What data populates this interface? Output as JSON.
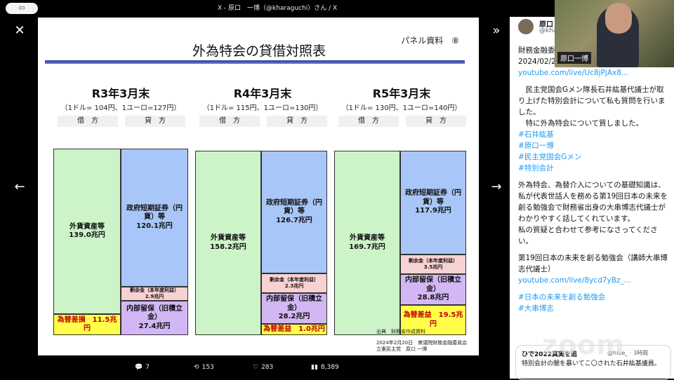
{
  "window": {
    "title": "X - 原口　一博（@kharaguchi）さん / X",
    "pill_label": "▭"
  },
  "slide": {
    "panel_note": "パネル資料　⑧",
    "title": "外為特会の貸借対照表",
    "columns": [
      {
        "heading": "R3年3月末",
        "rate": "（1ドル= 104円、1ユーロ=127円）",
        "left_hdr": "借　方",
        "right_hdr": "貸　方",
        "asset": [
          "外貨資産等",
          "139.0兆円"
        ],
        "liab": [
          "政府短期証券（円貨）等",
          "120.1兆円"
        ],
        "surplus": [
          "剰余金（本年度利益）",
          "2.9兆円"
        ],
        "reserve": [
          "内部留保（旧積立金）",
          "27.4兆円"
        ],
        "fx": "為替差損　11.5兆円"
      },
      {
        "heading": "R4年3月末",
        "rate": "（1ドル= 115円、1ユーロ=130円）",
        "left_hdr": "借　方",
        "right_hdr": "貸　方",
        "asset": [
          "外貨資産等",
          "158.2兆円"
        ],
        "liab": [
          "政府短期証券（円貨）等",
          "126.7兆円"
        ],
        "surplus": [
          "剰余金（本年度利益）",
          "2.3兆円"
        ],
        "reserve": [
          "内部留保（旧積立金）",
          "28.2兆円"
        ],
        "fx": "為替差益　1.0兆円"
      },
      {
        "heading": "R5年3月末",
        "rate": "（1ドル= 130円、1ユーロ=140円）",
        "left_hdr": "借　方",
        "right_hdr": "貸　方",
        "asset": [
          "外貨資産等",
          "169.7兆円"
        ],
        "liab": [
          "政府短期証券（円貨）等",
          "117.9兆円"
        ],
        "surplus": [
          "剰余金（本年度利益）",
          "3.5兆円"
        ],
        "reserve": [
          "内部留保（旧積立金）",
          "28.8兆円"
        ],
        "fx": "為替差益　19.5兆円"
      }
    ],
    "source": "出典　財務省作成資料",
    "footer_lines": [
      "2024年2月20日　衆議院財務金融委員会",
      "立憲民主党　原口 一博"
    ]
  },
  "actions": {
    "replies": "7",
    "reposts": "153",
    "likes": "283",
    "views": "8,389"
  },
  "sidebar": {
    "name": "原口",
    "handle": "@kha",
    "lines": [
      {
        "text": "財務金融委",
        "link": false
      },
      {
        "text": "2024/02/20",
        "link": false
      },
      {
        "text": "youtube.com/live/Uc8jPjAx8...",
        "link": true
      },
      {
        "text": "",
        "link": false
      },
      {
        "text": "　民主党国会Gメン隊長石井紘基代議士が取り上げた特別会計について私も質問を行いました。",
        "link": false
      },
      {
        "text": "　特に外為特会について質しました。",
        "link": false
      },
      {
        "text": "#石井紘基",
        "link": true
      },
      {
        "text": "#原口一博",
        "link": true
      },
      {
        "text": "#民主党国会Gメン",
        "link": true
      },
      {
        "text": "#特別会計",
        "link": true
      },
      {
        "text": "",
        "link": false
      },
      {
        "text": "外為特会、為替介入についての基礎知識は、私が代表世話人を務める第19回日本の未来を創る勉強会で財務省出身の大串博志代議士がわかりやすく話してくれています。",
        "link": false
      },
      {
        "text": "私の質疑と合わせて参考になさってください。",
        "link": false
      },
      {
        "text": "",
        "link": false
      },
      {
        "text": "第19回日本の未来を創る勉強会（講師大串博志代議士）",
        "link": false
      },
      {
        "text": "youtube.com/live/8ycd7yBz_...",
        "link": true
      },
      {
        "text": "",
        "link": false
      },
      {
        "text": "#日本の未来を創る勉強会",
        "link": true
      },
      {
        "text": "#大串博志",
        "link": true
      }
    ],
    "quote_head": "ひで2022真実を追",
    "quote_handle": "@hiue_ · 3時間",
    "quote_text": "特別会計の闇を暴いてこ〇された石井紘基議員。"
  },
  "video": {
    "caption": "原口一博"
  },
  "watermark": "zoom"
}
